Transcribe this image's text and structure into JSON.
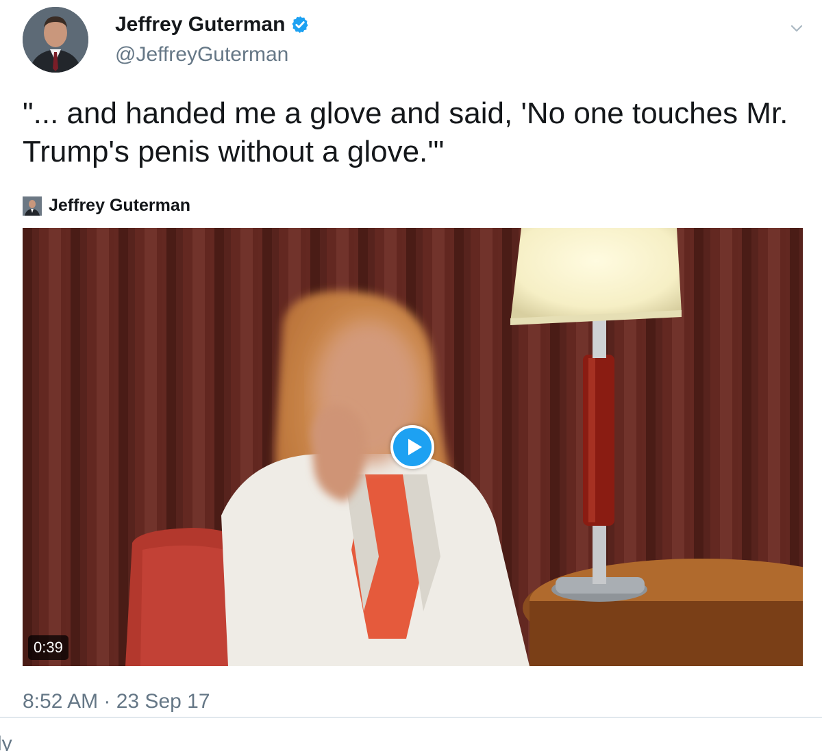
{
  "author": {
    "name": "Jeffrey Guterman",
    "handle": "@JeffreyGuterman",
    "verified_icon": "verified-badge-icon",
    "avatar_icon": "profile-photo"
  },
  "menu": {
    "icon": "chevron-down-icon"
  },
  "tweet": {
    "text": "\"... and handed me a glove and said, 'No one touches Mr. Trump's penis without a glove.'\""
  },
  "media": {
    "attribution": "Jeffrey Guterman",
    "duration": "0:39",
    "play_icon": "play-icon"
  },
  "meta": {
    "timestamp": "8:52 AM · 23 Sep 17"
  },
  "actions": {
    "reply_partial": "ly"
  },
  "colors": {
    "accent": "#1da1f2",
    "secondary_text": "#657786",
    "primary_text": "#14171a"
  }
}
